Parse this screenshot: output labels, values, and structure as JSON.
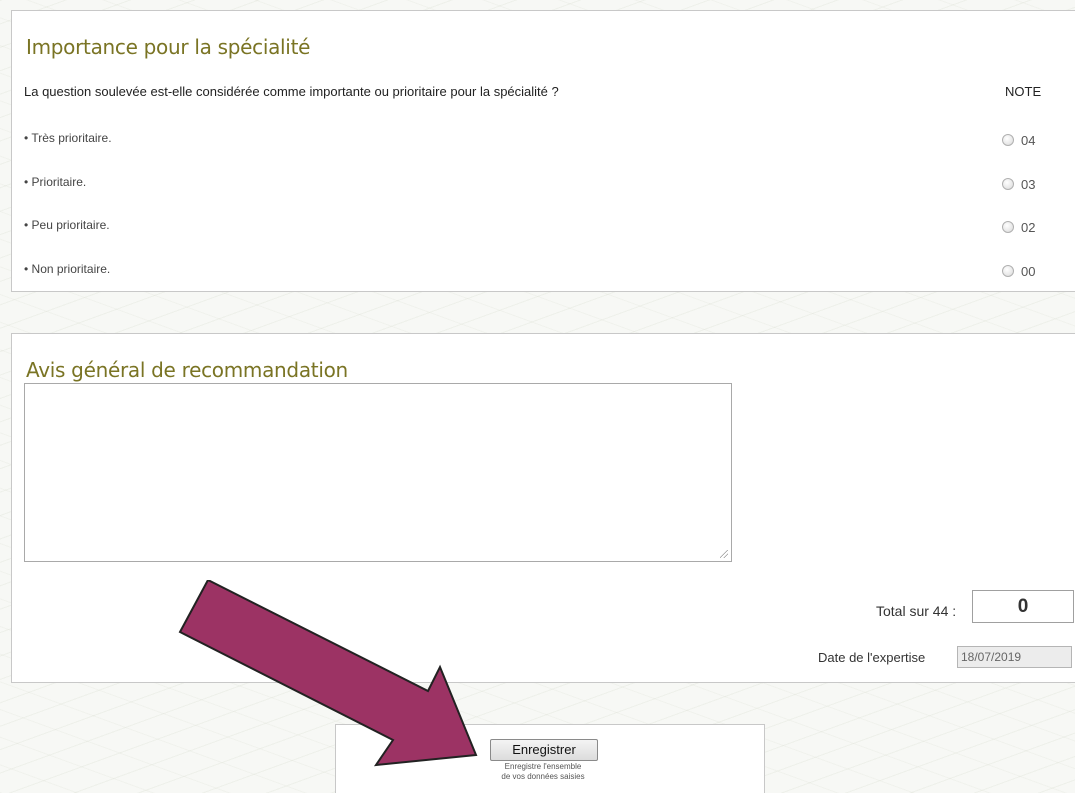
{
  "importance": {
    "title": "Importance pour la spécialité",
    "question": "La question soulevée est-elle considérée comme importante ou prioritaire pour la spécialité ?",
    "note_header": "NOTE",
    "options": [
      {
        "label": "• Très prioritaire.",
        "value": "04"
      },
      {
        "label": "• Prioritaire.",
        "value": "03"
      },
      {
        "label": "• Peu prioritaire.",
        "value": "02"
      },
      {
        "label": "• Non prioritaire.",
        "value": "00"
      }
    ]
  },
  "avis": {
    "title": "Avis général de recommandation",
    "text": "",
    "total_label": "Total sur 44 :",
    "total_value": "0",
    "date_label": "Date de l'expertise",
    "date_value": "18/07/2019"
  },
  "save": {
    "button_label": "Enregistrer",
    "help_line1": "Enregistre l'ensemble",
    "help_line2": "de vos données saisies"
  },
  "colors": {
    "title": "#7a7424",
    "arrow": "#9c3364"
  }
}
